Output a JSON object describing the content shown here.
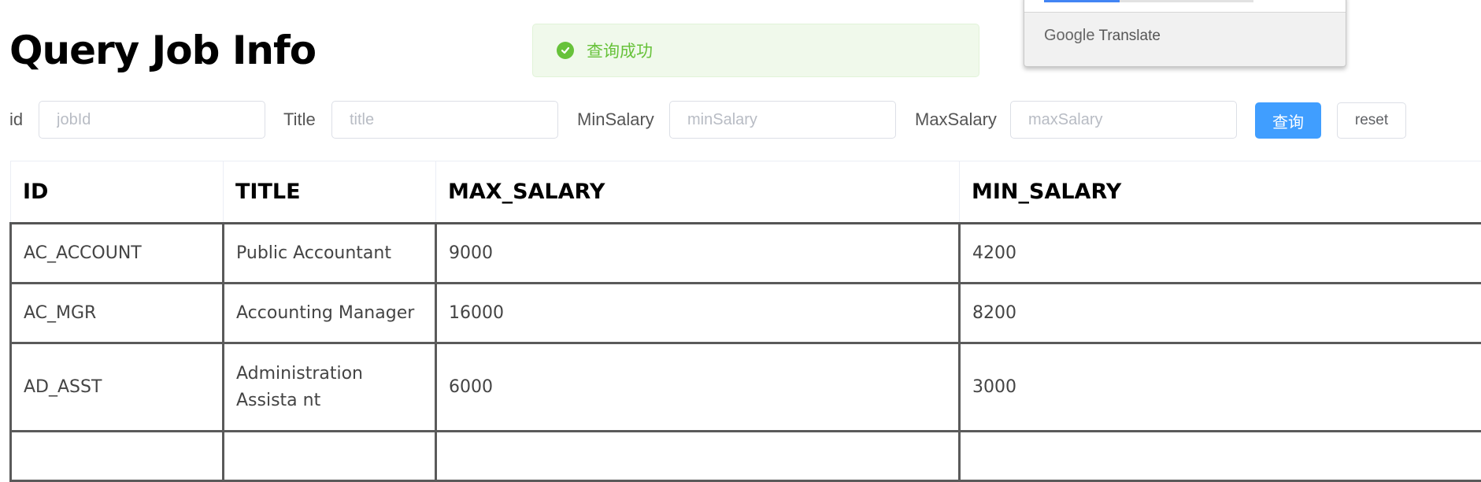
{
  "page": {
    "title": "Query Job Info"
  },
  "toast": {
    "message": "查询成功",
    "icon": "check-circle-icon",
    "color": "#67c23a"
  },
  "translate_popup": {
    "brand_google": "Google",
    "brand_translate": "Translate"
  },
  "search_form": {
    "id_label": "id",
    "id_placeholder": "jobId",
    "id_value": "",
    "title_label": "Title",
    "title_placeholder": "title",
    "title_value": "",
    "min_label": "MinSalary",
    "min_placeholder": "minSalary",
    "min_value": "",
    "max_label": "MaxSalary",
    "max_placeholder": "maxSalary",
    "max_value": "",
    "query_button": "查询",
    "reset_button": "reset",
    "primary_color": "#409eff"
  },
  "table": {
    "columns": [
      "ID",
      "TITLE",
      "MAX_SALARY",
      "MIN_SALARY"
    ],
    "rows": [
      {
        "id": "AC_ACCOUNT",
        "title": "Public Accountant",
        "max_salary": "9000",
        "min_salary": "4200"
      },
      {
        "id": "AC_MGR",
        "title": "Accounting Manager",
        "max_salary": "16000",
        "min_salary": "8200"
      },
      {
        "id": "AD_ASST",
        "title": "Administration Assista nt",
        "max_salary": "6000",
        "min_salary": "3000"
      }
    ]
  }
}
